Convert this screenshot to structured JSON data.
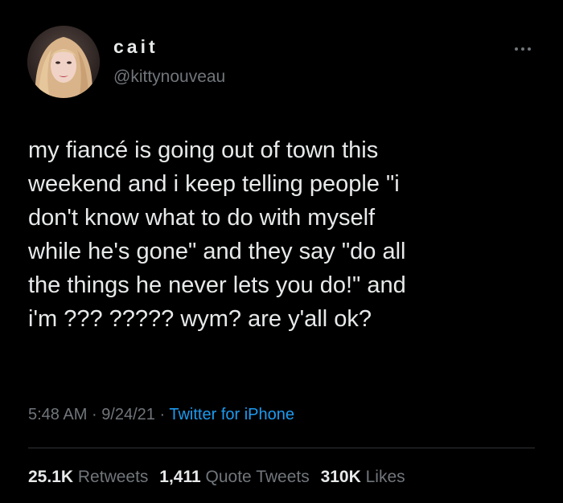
{
  "colors": {
    "background": "#000000",
    "primary_text": "#e7e9ea",
    "secondary_text": "#71767b",
    "accent": "#1d9bf0",
    "divider": "#2f3336"
  },
  "author": {
    "display_name": "cait",
    "handle": "@kittynouveau",
    "avatar_icon": "profile-photo"
  },
  "more_icon": "more-horizontal-icon",
  "tweet": {
    "text": "my fiancé is going out of town this\nweekend and i keep telling people \"i\ndon't know what to do with myself\nwhile he's gone\" and they say \"do all\nthe things he never lets you do!\" and\ni'm ??? ????? wym? are y'all ok?",
    "time": "5:48 AM",
    "date": "9/24/21",
    "separator": "·",
    "source": "Twitter for iPhone"
  },
  "stats": {
    "retweets_count": "25.1K",
    "retweets_label": "Retweets",
    "quotes_count": "1,411",
    "quotes_label": "Quote Tweets",
    "likes_count": "310K",
    "likes_label": "Likes"
  }
}
